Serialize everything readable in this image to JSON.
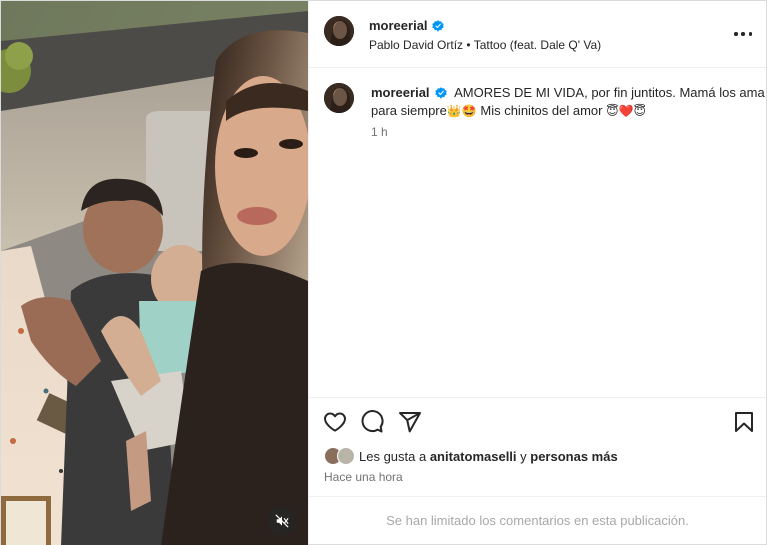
{
  "post": {
    "username": "moreerial",
    "header_subtitle": {
      "artist": "Pablo David Ortíz",
      "separator": "•",
      "song": "Tattoo (feat. Dale Q' Va)"
    },
    "caption": {
      "text": "AMORES DE MI VIDA, por fin juntitos. Mamá los ama para siempre",
      "emoji_1": "👑🤩",
      "text_2": " Mis chinitos del amor ",
      "emoji_2": "😇❤️😇"
    },
    "caption_time": "1 h",
    "likes": {
      "prefix": "Les gusta a ",
      "user": "anitatomaselli",
      "middle": " y ",
      "others": "personas más"
    },
    "posted_time": "Hace una hora",
    "comments_notice": "Se han limitado los comentarios en esta publicación."
  },
  "icons": {
    "verified": "verified-badge-icon",
    "more": "more-options-icon",
    "like": "heart-icon",
    "comment": "comment-icon",
    "share": "share-icon",
    "save": "bookmark-icon",
    "mute": "muted-speaker-icon"
  },
  "colors": {
    "verified": "#0095f6",
    "text": "#262626",
    "secondary_text": "#737373",
    "muted_text": "#a8a8a8",
    "divider": "#efefef"
  }
}
